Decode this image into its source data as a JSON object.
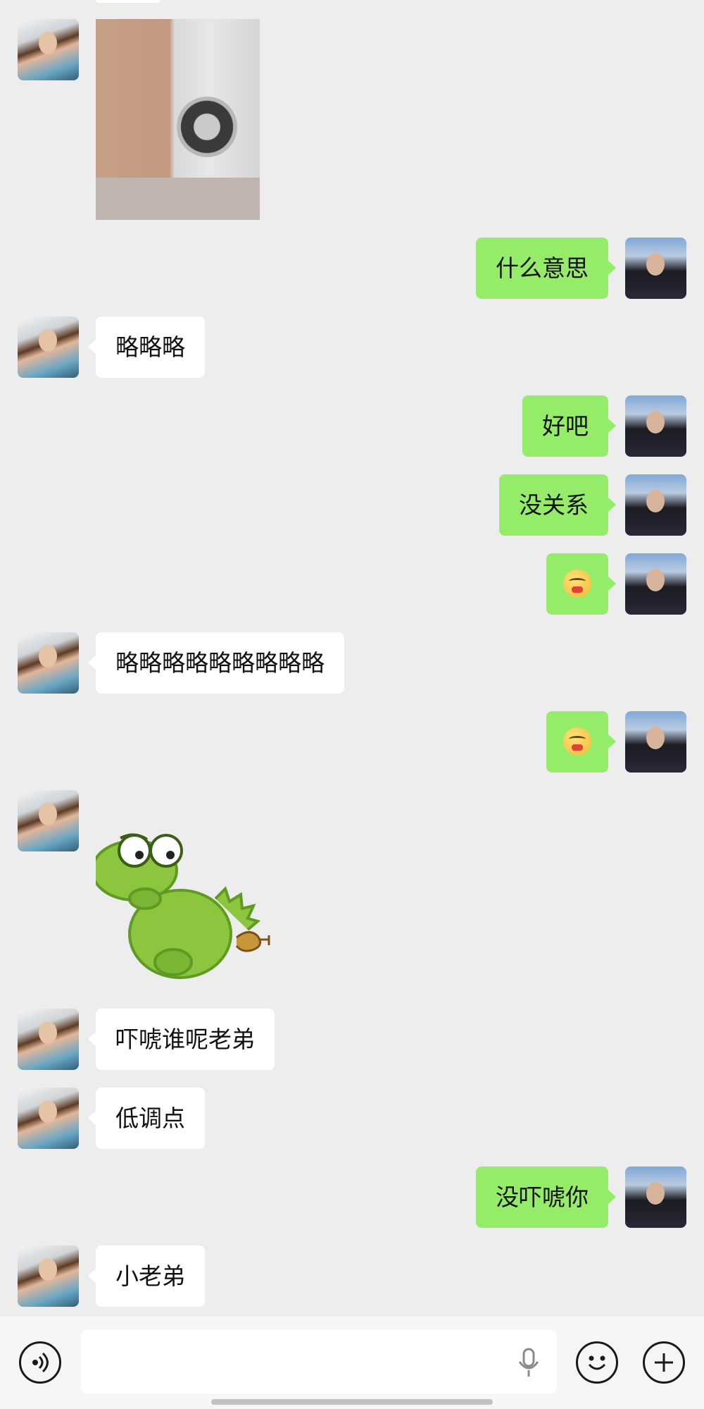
{
  "conversation": {
    "messages": [
      {
        "sender": "friend",
        "kind": "image"
      },
      {
        "sender": "me",
        "kind": "text",
        "text": "什么意思"
      },
      {
        "sender": "friend",
        "kind": "text",
        "text": "略略略"
      },
      {
        "sender": "me",
        "kind": "text",
        "text": "好吧"
      },
      {
        "sender": "me",
        "kind": "text",
        "text": "没关系"
      },
      {
        "sender": "me",
        "kind": "emoji",
        "emoji": "face-with-hand-over-mouth-icon"
      },
      {
        "sender": "friend",
        "kind": "text",
        "text": "略略略略略略略略略"
      },
      {
        "sender": "me",
        "kind": "emoji",
        "emoji": "face-with-hand-over-mouth-icon"
      },
      {
        "sender": "friend",
        "kind": "sticker",
        "sticker": "green-dinosaur-sticker"
      },
      {
        "sender": "friend",
        "kind": "text",
        "text": "吓唬谁呢老弟"
      },
      {
        "sender": "friend",
        "kind": "text",
        "text": "低调点"
      },
      {
        "sender": "me",
        "kind": "text",
        "text": "没吓唬你"
      },
      {
        "sender": "friend",
        "kind": "text",
        "text": "小老弟"
      }
    ]
  },
  "input_bar": {
    "voice_icon": "voice-mode-icon",
    "mic_icon": "microphone-icon",
    "emoji_icon": "smiley-icon",
    "more_icon": "plus-icon",
    "text_value": ""
  },
  "colors": {
    "background": "#ededed",
    "outgoing_bubble": "#95ec69",
    "incoming_bubble": "#ffffff"
  }
}
